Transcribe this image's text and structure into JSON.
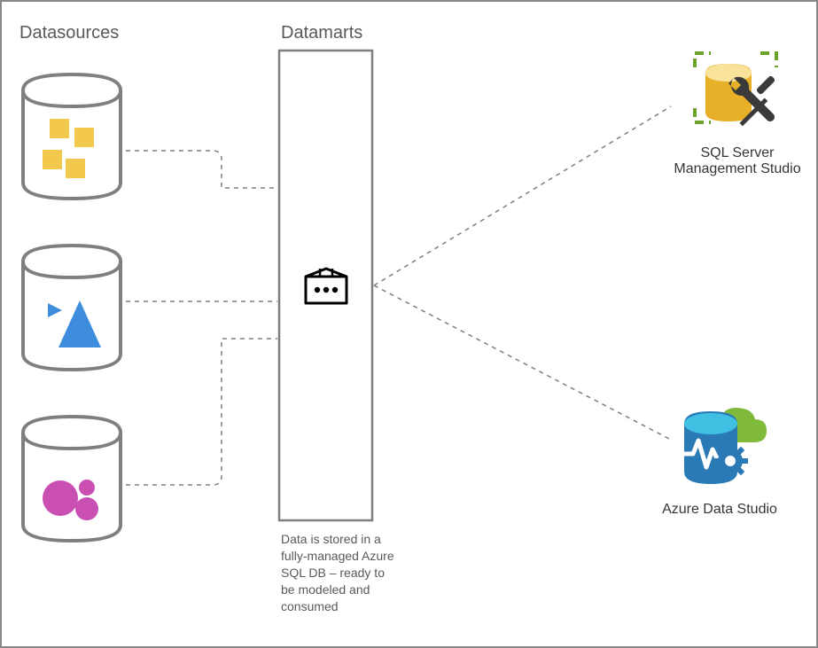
{
  "headings": {
    "datasources": "Datasources",
    "datamarts": "Datamarts"
  },
  "datamart_caption": "Data is stored in a fully-managed Azure SQL DB – ready to be modeled and consumed",
  "tools": {
    "ssms": {
      "line1": "SQL Server",
      "line2": "Management Studio"
    },
    "ads": {
      "line1": "Azure Data Studio"
    }
  },
  "colors": {
    "cylinder_stroke": "#7f7f7f",
    "yellow": "#f2c94c",
    "blue": "#3e8ddd",
    "magenta": "#c94fb3",
    "dashed": "#7f7f7f",
    "ssms_gold": "#e8b029",
    "ssms_green": "#6ea22b",
    "ads_blue": "#2a7ab5",
    "ads_cyan": "#3fbfe2",
    "ads_green": "#7fba3b"
  }
}
